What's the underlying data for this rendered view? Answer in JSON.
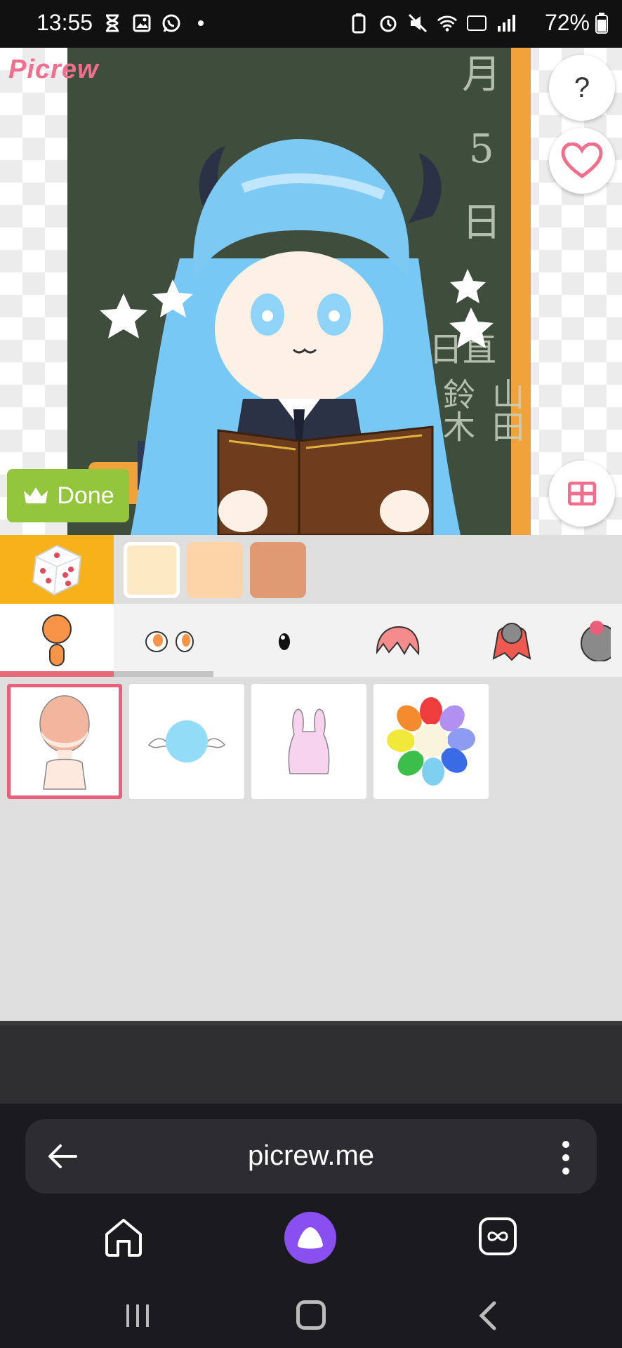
{
  "status_bar": {
    "time": "13:55",
    "battery": "72%",
    "left_icons": [
      "hourglass-icon",
      "image-icon",
      "whatsapp-icon",
      "dot-icon"
    ],
    "right_icons": [
      "battery-saver-icon",
      "alarm-icon",
      "mute-icon",
      "wifi-icon",
      "volte-icon",
      "signal-icon"
    ]
  },
  "canvas": {
    "logo": "Picrew",
    "chalkboard_text": [
      "月",
      "5",
      "日",
      "日直",
      "鈴木",
      "山田"
    ],
    "help_label": "?",
    "done_label": "Done"
  },
  "color_swatches": [
    {
      "color": "#fde9c4"
    },
    {
      "color": "#fcd4a8"
    },
    {
      "color": "#df9a73"
    }
  ],
  "category_tabs": [
    {
      "name": "body",
      "active": true
    },
    {
      "name": "eyes",
      "active": false
    },
    {
      "name": "mouth",
      "active": false
    },
    {
      "name": "front-hair",
      "active": false
    },
    {
      "name": "back-hair",
      "active": false
    },
    {
      "name": "accessory",
      "active": false
    }
  ],
  "items": [
    {
      "name": "body-base",
      "selected": true
    },
    {
      "name": "winged-blob",
      "selected": false
    },
    {
      "name": "bunny-ears",
      "selected": false
    },
    {
      "name": "rainbow-flower",
      "selected": false
    }
  ],
  "browser": {
    "url": "picrew.me"
  },
  "colors": {
    "accent": "#e8607a",
    "done_green": "#93c53d",
    "dice_orange": "#f7b21a",
    "frame_orange": "#f0a23b",
    "assistant_purple": "#8a4ff0"
  }
}
